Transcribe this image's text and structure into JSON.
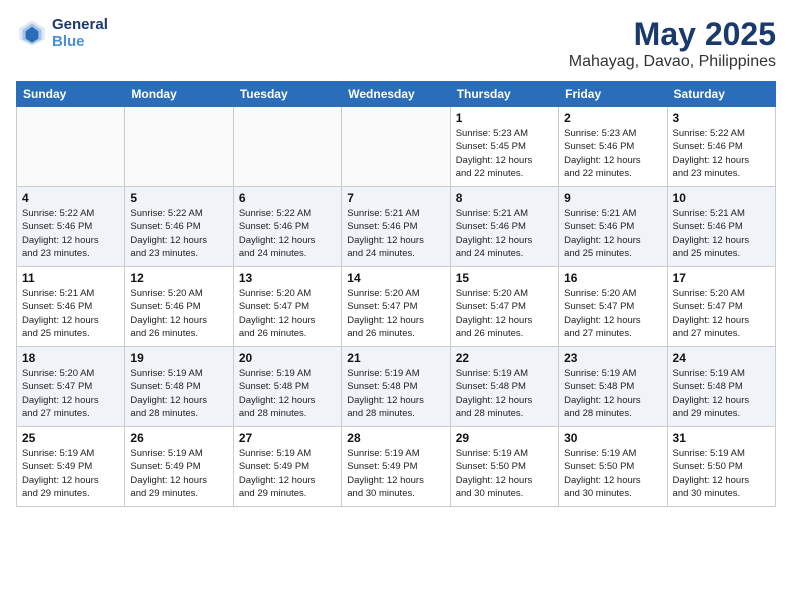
{
  "header": {
    "logo_line1": "General",
    "logo_line2": "Blue",
    "month": "May 2025",
    "location": "Mahayag, Davao, Philippines"
  },
  "weekdays": [
    "Sunday",
    "Monday",
    "Tuesday",
    "Wednesday",
    "Thursday",
    "Friday",
    "Saturday"
  ],
  "weeks": [
    [
      {
        "day": "",
        "info": ""
      },
      {
        "day": "",
        "info": ""
      },
      {
        "day": "",
        "info": ""
      },
      {
        "day": "",
        "info": ""
      },
      {
        "day": "1",
        "info": "Sunrise: 5:23 AM\nSunset: 5:45 PM\nDaylight: 12 hours\nand 22 minutes."
      },
      {
        "day": "2",
        "info": "Sunrise: 5:23 AM\nSunset: 5:46 PM\nDaylight: 12 hours\nand 22 minutes."
      },
      {
        "day": "3",
        "info": "Sunrise: 5:22 AM\nSunset: 5:46 PM\nDaylight: 12 hours\nand 23 minutes."
      }
    ],
    [
      {
        "day": "4",
        "info": "Sunrise: 5:22 AM\nSunset: 5:46 PM\nDaylight: 12 hours\nand 23 minutes."
      },
      {
        "day": "5",
        "info": "Sunrise: 5:22 AM\nSunset: 5:46 PM\nDaylight: 12 hours\nand 23 minutes."
      },
      {
        "day": "6",
        "info": "Sunrise: 5:22 AM\nSunset: 5:46 PM\nDaylight: 12 hours\nand 24 minutes."
      },
      {
        "day": "7",
        "info": "Sunrise: 5:21 AM\nSunset: 5:46 PM\nDaylight: 12 hours\nand 24 minutes."
      },
      {
        "day": "8",
        "info": "Sunrise: 5:21 AM\nSunset: 5:46 PM\nDaylight: 12 hours\nand 24 minutes."
      },
      {
        "day": "9",
        "info": "Sunrise: 5:21 AM\nSunset: 5:46 PM\nDaylight: 12 hours\nand 25 minutes."
      },
      {
        "day": "10",
        "info": "Sunrise: 5:21 AM\nSunset: 5:46 PM\nDaylight: 12 hours\nand 25 minutes."
      }
    ],
    [
      {
        "day": "11",
        "info": "Sunrise: 5:21 AM\nSunset: 5:46 PM\nDaylight: 12 hours\nand 25 minutes."
      },
      {
        "day": "12",
        "info": "Sunrise: 5:20 AM\nSunset: 5:46 PM\nDaylight: 12 hours\nand 26 minutes."
      },
      {
        "day": "13",
        "info": "Sunrise: 5:20 AM\nSunset: 5:47 PM\nDaylight: 12 hours\nand 26 minutes."
      },
      {
        "day": "14",
        "info": "Sunrise: 5:20 AM\nSunset: 5:47 PM\nDaylight: 12 hours\nand 26 minutes."
      },
      {
        "day": "15",
        "info": "Sunrise: 5:20 AM\nSunset: 5:47 PM\nDaylight: 12 hours\nand 26 minutes."
      },
      {
        "day": "16",
        "info": "Sunrise: 5:20 AM\nSunset: 5:47 PM\nDaylight: 12 hours\nand 27 minutes."
      },
      {
        "day": "17",
        "info": "Sunrise: 5:20 AM\nSunset: 5:47 PM\nDaylight: 12 hours\nand 27 minutes."
      }
    ],
    [
      {
        "day": "18",
        "info": "Sunrise: 5:20 AM\nSunset: 5:47 PM\nDaylight: 12 hours\nand 27 minutes."
      },
      {
        "day": "19",
        "info": "Sunrise: 5:19 AM\nSunset: 5:48 PM\nDaylight: 12 hours\nand 28 minutes."
      },
      {
        "day": "20",
        "info": "Sunrise: 5:19 AM\nSunset: 5:48 PM\nDaylight: 12 hours\nand 28 minutes."
      },
      {
        "day": "21",
        "info": "Sunrise: 5:19 AM\nSunset: 5:48 PM\nDaylight: 12 hours\nand 28 minutes."
      },
      {
        "day": "22",
        "info": "Sunrise: 5:19 AM\nSunset: 5:48 PM\nDaylight: 12 hours\nand 28 minutes."
      },
      {
        "day": "23",
        "info": "Sunrise: 5:19 AM\nSunset: 5:48 PM\nDaylight: 12 hours\nand 28 minutes."
      },
      {
        "day": "24",
        "info": "Sunrise: 5:19 AM\nSunset: 5:48 PM\nDaylight: 12 hours\nand 29 minutes."
      }
    ],
    [
      {
        "day": "25",
        "info": "Sunrise: 5:19 AM\nSunset: 5:49 PM\nDaylight: 12 hours\nand 29 minutes."
      },
      {
        "day": "26",
        "info": "Sunrise: 5:19 AM\nSunset: 5:49 PM\nDaylight: 12 hours\nand 29 minutes."
      },
      {
        "day": "27",
        "info": "Sunrise: 5:19 AM\nSunset: 5:49 PM\nDaylight: 12 hours\nand 29 minutes."
      },
      {
        "day": "28",
        "info": "Sunrise: 5:19 AM\nSunset: 5:49 PM\nDaylight: 12 hours\nand 30 minutes."
      },
      {
        "day": "29",
        "info": "Sunrise: 5:19 AM\nSunset: 5:50 PM\nDaylight: 12 hours\nand 30 minutes."
      },
      {
        "day": "30",
        "info": "Sunrise: 5:19 AM\nSunset: 5:50 PM\nDaylight: 12 hours\nand 30 minutes."
      },
      {
        "day": "31",
        "info": "Sunrise: 5:19 AM\nSunset: 5:50 PM\nDaylight: 12 hours\nand 30 minutes."
      }
    ]
  ]
}
